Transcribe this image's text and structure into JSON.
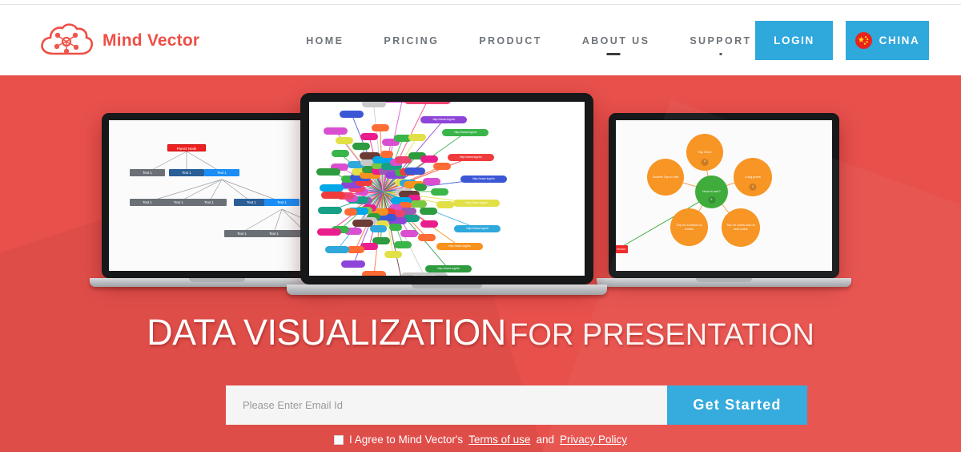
{
  "brand": {
    "name": "Mind Vector",
    "logo_icon": "cloud-network-icon",
    "color": "#ee4e45"
  },
  "nav": {
    "items": [
      {
        "label": "HOME"
      },
      {
        "label": "PRICING"
      },
      {
        "label": "PRODUCT"
      },
      {
        "label": "ABOUT US"
      },
      {
        "label": "SUPPORT"
      }
    ]
  },
  "actions": {
    "login_label": "LOGIN",
    "country_label": "CHINA",
    "flag_icon": "china-flag-icon",
    "button_color": "#2fa8dc"
  },
  "hero": {
    "background_color": "#e8504c",
    "headline_strong": "DATA VISUALIZATION",
    "headline_light": "FOR PRESENTATION"
  },
  "signup": {
    "email_placeholder": "Please Enter Email Id",
    "email_value": "",
    "submit_label": "Get Started",
    "agree_prefix": "I Agree to Mind Vector's",
    "terms_label": "Terms of use",
    "agree_conjunction": "and",
    "privacy_label": "Privacy Policy",
    "checkbox_checked": false
  },
  "screens": {
    "left": {
      "title": "tree-mindmap",
      "root_label": "Parent Node",
      "child_label": "Text 1",
      "rows": [
        {
          "count": 3,
          "colors": [
            "grey",
            "dblue",
            "blue"
          ]
        },
        {
          "count": 5,
          "colors": [
            "grey",
            "grey",
            "grey",
            "dblue",
            "blue"
          ]
        },
        {
          "count": 3,
          "colors": [
            "grey",
            "grey",
            "grey"
          ]
        }
      ]
    },
    "center": {
      "title": "radial-url-mindmap",
      "node_label": "http://www.log/xlx",
      "outer_nodes": [
        {
          "label": "http://www.log/xlx",
          "color": "#d94fd0"
        },
        {
          "label": "http://www.log/xlx",
          "color": "#ee4370"
        },
        {
          "label": "http://www.log/xlx",
          "color": "#8e44d8"
        },
        {
          "label": "http://www.log/xlx",
          "color": "#39b54a"
        },
        {
          "label": "http://www.log/xlx",
          "color": "#ef3b3b"
        },
        {
          "label": "http://www.log/xlx",
          "color": "#3c57d6"
        },
        {
          "label": "http://www.log/xlx",
          "color": "#e2e047"
        },
        {
          "label": "http://www.log/xlx",
          "color": "#2fa8dc"
        },
        {
          "label": "http://www.log/xlx",
          "color": "#f7921e"
        },
        {
          "label": "http://www.log/xlx",
          "color": "#2e9b3e"
        },
        {
          "label": "http://www.log/xlx",
          "color": "#c9c9c9"
        },
        {
          "label": "http://www.log/xlx",
          "color": "#6b3b36"
        }
      ]
    },
    "right": {
      "title": "bubble-mindmap",
      "center_label": "How to use?",
      "center_color": "#3aa935",
      "node_color": "#f7921e",
      "nodes": [
        {
          "label": "Tap Once",
          "badge": "4"
        },
        {
          "label": "Long press",
          "badge": "3"
        },
        {
          "label": "Double Tap to edit",
          "badge": ""
        },
        {
          "label": "Tap on a button of nodes",
          "badge": ""
        },
        {
          "label": "Tap on notes icon to add notes",
          "badge": ""
        }
      ],
      "side_box_label": "Mind Vector"
    }
  }
}
